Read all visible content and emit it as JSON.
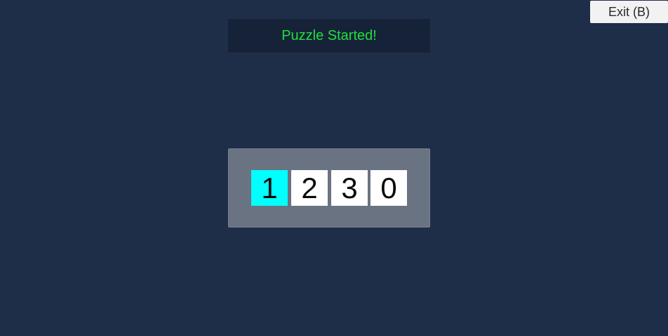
{
  "exit_button": {
    "label": "Exit (B)"
  },
  "status": {
    "message": "Puzzle Started!",
    "color": "#1ee03c"
  },
  "code_lock": {
    "digits": [
      "1",
      "2",
      "3",
      "0"
    ],
    "selected_index": 0,
    "selected_color": "#00ffff"
  }
}
